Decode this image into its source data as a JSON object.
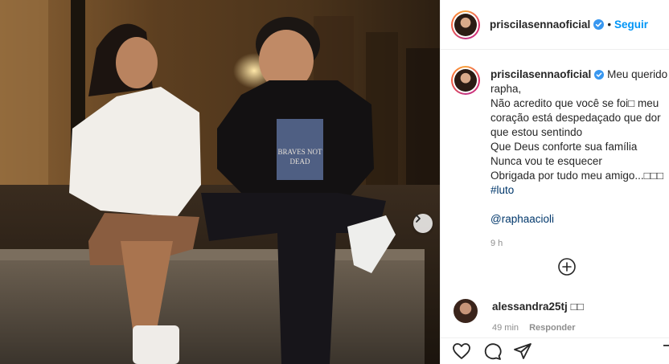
{
  "header": {
    "username": "priscilasennaoficial",
    "separator": "•",
    "follow_label": "Seguir"
  },
  "caption": {
    "username": "priscilasennaoficial",
    "lines": [
      "Meu querido",
      "rapha,",
      "Não acredito que você se foi□ meu",
      "coração está despedaçado que dor",
      "que estou sentindo",
      "Que Deus conforte sua família",
      "Nunca vou te esquecer",
      "Obrigada por tudo meu amigo...□□□"
    ],
    "hashtag": "#luto",
    "mention": "@raphaacioli",
    "time": "9 h"
  },
  "comment": {
    "username": "alessandra25tj",
    "text": "□□",
    "time": "49 min",
    "reply_label": "Responder"
  },
  "photo": {
    "shirt_text_line1": "BRAVES NOT",
    "shirt_text_line2": "DEAD"
  },
  "colors": {
    "accent": "#0095f6",
    "link": "#00376b",
    "muted": "#8e8e8e",
    "verified": "#3897f0"
  }
}
